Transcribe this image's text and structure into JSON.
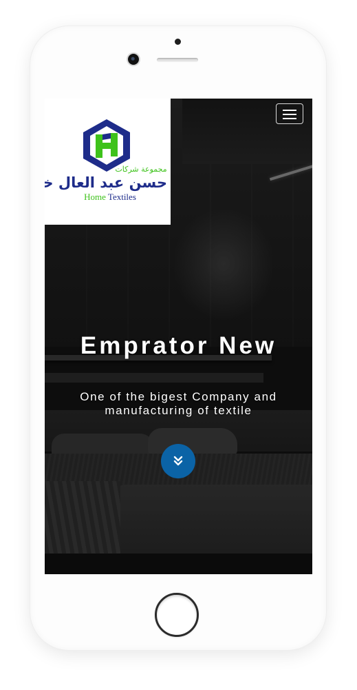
{
  "logo": {
    "arabic_small": "مجموعة شركات",
    "arabic_name": "حسن عبد العال خاطر",
    "english_word1": "Home",
    "english_word2": "Textiles",
    "colors": {
      "green": "#3ec21b",
      "navy": "#1e2c8a"
    }
  },
  "nav": {
    "menu_icon": "hamburger-menu-icon"
  },
  "hero": {
    "title": "Emprator New",
    "subtitle": "One of the bigest Company and manufacturing of textile",
    "scroll_icon": "double-chevron-down-icon",
    "accent_color": "#0b63a6"
  }
}
